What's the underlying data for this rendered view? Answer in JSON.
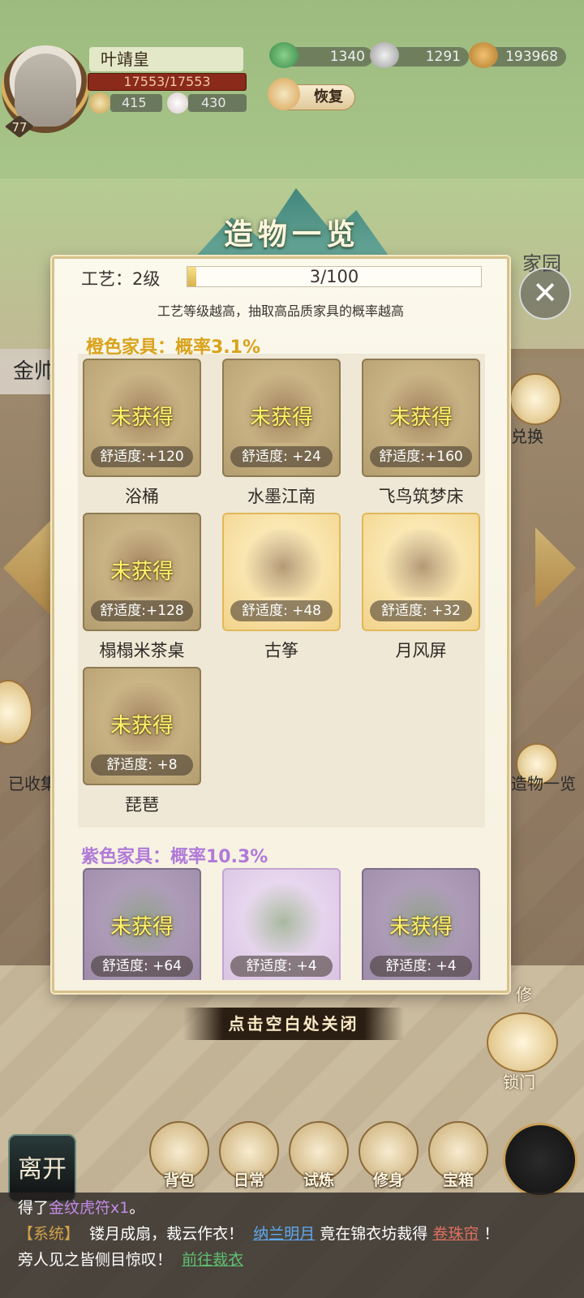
{
  "hud": {
    "player_name": "叶靖皇",
    "level": "77",
    "hp": "17553/17553",
    "stat_a": "415",
    "stat_b": "430",
    "currency_a": "1340",
    "currency_b": "1291",
    "currency_c": "193968",
    "restore_label": "恢复"
  },
  "side": {
    "jin_label": "金帅",
    "collected_label": "已收集",
    "home_label": "家园",
    "exchange_label": "兑换",
    "overview_label": "造物一览",
    "repair_label": "修",
    "lock_label": "锁门"
  },
  "modal": {
    "title": "造物一览",
    "craft_label": "工艺：2级",
    "craft_progress": "3/100",
    "craft_fraction": 0.03,
    "craft_hint": "工艺等级越高，抽取高品质家具的概率越高",
    "close_tip": "点击空白处关闭",
    "sections": [
      {
        "header": "橙色家具：概率3.1%",
        "color": "#d9a21a",
        "items": [
          {
            "name": "浴桶",
            "status": "未获得",
            "comfort": "舒适度:+120",
            "owned": false,
            "art": "bathtub-icon"
          },
          {
            "name": "水墨江南",
            "status": "未获得",
            "comfort": "舒适度: +24",
            "owned": false,
            "art": "folding-screen-icon"
          },
          {
            "name": "飞鸟筑梦床",
            "status": "未获得",
            "comfort": "舒适度:+160",
            "owned": false,
            "art": "canopy-bed-icon"
          },
          {
            "name": "榻榻米茶桌",
            "status": "未获得",
            "comfort": "舒适度:+128",
            "owned": false,
            "art": "tea-table-icon"
          },
          {
            "name": "古筝",
            "status": "",
            "comfort": "舒适度: +48",
            "owned": true,
            "art": "guzheng-icon"
          },
          {
            "name": "月风屏",
            "status": "",
            "comfort": "舒适度: +32",
            "owned": true,
            "art": "moon-screen-icon"
          },
          {
            "name": "琵琶",
            "status": "未获得",
            "comfort": "舒适度: +8",
            "owned": false,
            "art": "pipa-icon"
          }
        ]
      },
      {
        "header": "紫色家具：概率10.3%",
        "color": "#b07ad8",
        "items": [
          {
            "name": "",
            "status": "未获得",
            "comfort": "舒适度: +64",
            "owned": false,
            "art": "curtain-icon"
          },
          {
            "name": "",
            "status": "",
            "comfort": "舒适度: +4",
            "owned": true,
            "art": "flower-pot-icon"
          },
          {
            "name": "",
            "status": "未获得",
            "comfort": "舒适度: +4",
            "owned": false,
            "art": "plant-stand-icon"
          }
        ]
      }
    ]
  },
  "nav": {
    "leave_label": "离开",
    "items": [
      {
        "label": "背包"
      },
      {
        "label": "日常"
      },
      {
        "label": "试炼"
      },
      {
        "label": "修身"
      },
      {
        "label": "宝箱"
      }
    ]
  },
  "chat": {
    "line1_prefix": "得了",
    "line1_item": "金纹虎符x1",
    "line1_suffix": "。",
    "line2_tag": "【系统】",
    "line2_text": "镂月成扇，裁云作衣！",
    "line2_name": "纳兰明月",
    "line2_mid": "竟在锦衣坊裁得",
    "line2_item": "卷珠帘",
    "line2_end": "！",
    "line3_text": "旁人见之皆侧目惊叹！",
    "line3_link": "前往裁衣"
  }
}
